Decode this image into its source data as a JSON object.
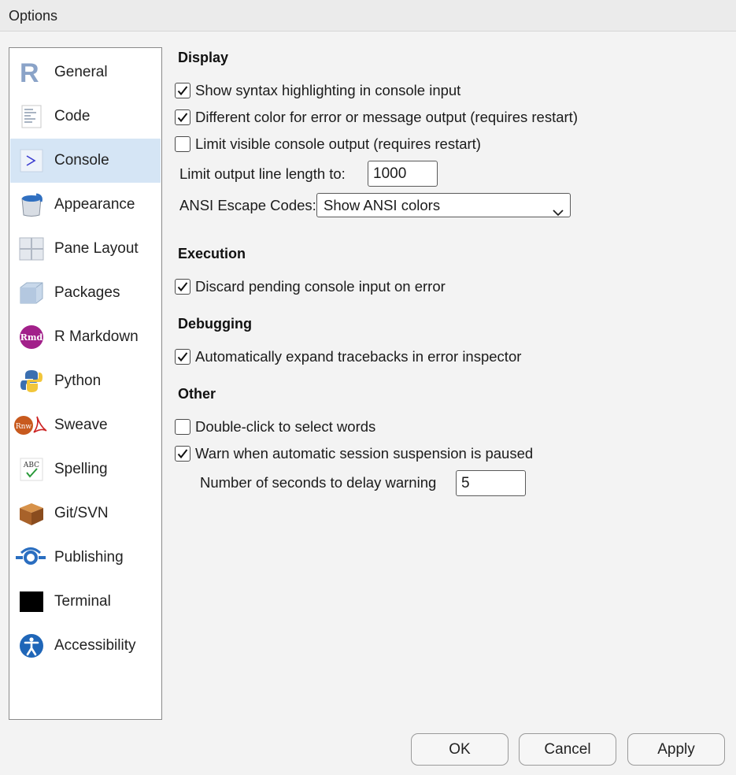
{
  "window": {
    "title": "Options"
  },
  "sidebar": {
    "items": [
      {
        "label": "General",
        "icon": "r-logo-icon"
      },
      {
        "label": "Code",
        "icon": "code-document-icon"
      },
      {
        "label": "Console",
        "icon": "console-prompt-icon",
        "selected": true
      },
      {
        "label": "Appearance",
        "icon": "paint-bucket-icon"
      },
      {
        "label": "Pane Layout",
        "icon": "pane-layout-icon"
      },
      {
        "label": "Packages",
        "icon": "package-box-icon"
      },
      {
        "label": "R Markdown",
        "icon": "rmd-icon"
      },
      {
        "label": "Python",
        "icon": "python-icon"
      },
      {
        "label": "Sweave",
        "icon": "sweave-pdf-icon"
      },
      {
        "label": "Spelling",
        "icon": "spelling-check-icon"
      },
      {
        "label": "Git/SVN",
        "icon": "git-box-icon"
      },
      {
        "label": "Publishing",
        "icon": "publishing-icon"
      },
      {
        "label": "Terminal",
        "icon": "terminal-icon"
      },
      {
        "label": "Accessibility",
        "icon": "accessibility-icon"
      }
    ]
  },
  "display": {
    "heading": "Display",
    "syntax_highlighting": {
      "label": "Show syntax highlighting in console input",
      "checked": true
    },
    "different_color": {
      "label": "Different color for error or message output (requires restart)",
      "checked": true
    },
    "limit_visible": {
      "label": "Limit visible console output (requires restart)",
      "checked": false
    },
    "line_length_label": "Limit output line length to:",
    "line_length_value": "1000",
    "ansi_label": "ANSI Escape Codes:",
    "ansi_value": "Show ANSI colors"
  },
  "execution": {
    "heading": "Execution",
    "discard_pending": {
      "label": "Discard pending console input on error",
      "checked": true
    }
  },
  "debugging": {
    "heading": "Debugging",
    "expand_tracebacks": {
      "label": "Automatically expand tracebacks in error inspector",
      "checked": true
    }
  },
  "other": {
    "heading": "Other",
    "double_click": {
      "label": "Double-click to select words",
      "checked": false
    },
    "warn_suspension": {
      "label": "Warn when automatic session suspension is paused",
      "checked": true
    },
    "delay_label": "Number of seconds to delay warning",
    "delay_value": "5"
  },
  "buttons": {
    "ok": "OK",
    "cancel": "Cancel",
    "apply": "Apply"
  },
  "colors": {
    "selected_bg": "#d5e5f5",
    "accent": "#3a6fb0"
  }
}
